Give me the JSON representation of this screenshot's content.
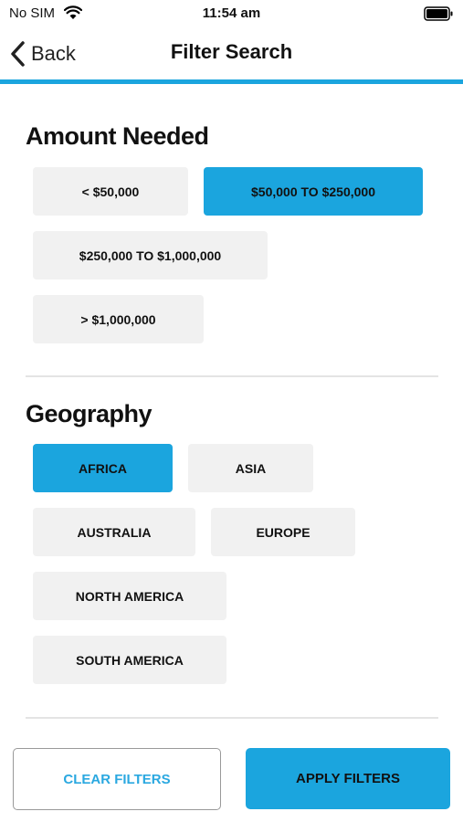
{
  "status_bar": {
    "carrier": "No SIM",
    "time": "11:54 am"
  },
  "nav": {
    "back_label": "Back",
    "title": "Filter Search"
  },
  "amount_section": {
    "title": "Amount Needed",
    "options": [
      {
        "label": "< $50,000",
        "selected": false
      },
      {
        "label": "$50,000 TO $250,000",
        "selected": true
      },
      {
        "label": "$250,000 TO $1,000,000",
        "selected": false
      },
      {
        "label": "> $1,000,000",
        "selected": false
      }
    ]
  },
  "geography_section": {
    "title": "Geography",
    "options": [
      {
        "label": "AFRICA",
        "selected": true
      },
      {
        "label": "ASIA",
        "selected": false
      },
      {
        "label": "AUSTRALIA",
        "selected": false
      },
      {
        "label": "EUROPE",
        "selected": false
      },
      {
        "label": "NORTH AMERICA",
        "selected": false
      },
      {
        "label": "SOUTH AMERICA",
        "selected": false
      }
    ]
  },
  "actions": {
    "clear_label": "CLEAR FILTERS",
    "apply_label": "APPLY FILTERS"
  },
  "colors": {
    "accent": "#1ba5de",
    "chip_bg": "#f1f1f1"
  }
}
